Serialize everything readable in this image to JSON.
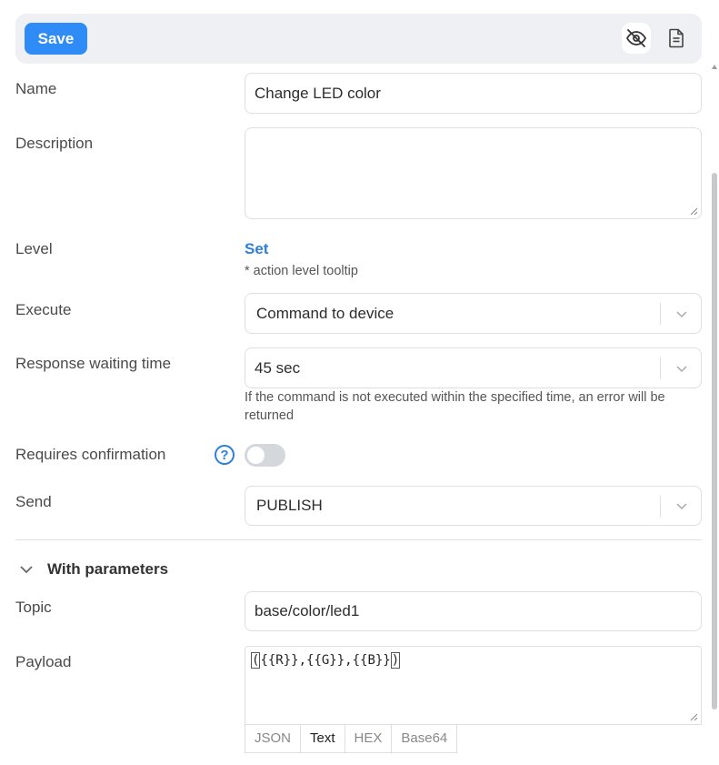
{
  "toolbar": {
    "save_label": "Save",
    "hide_icon": "eye-off-icon",
    "doc_icon": "document-icon"
  },
  "form": {
    "name": {
      "label": "Name",
      "value": "Change LED color"
    },
    "description": {
      "label": "Description",
      "value": ""
    },
    "level": {
      "label": "Level",
      "link": "Set",
      "hint": "* action level tooltip"
    },
    "execute": {
      "label": "Execute",
      "value": "Command to device"
    },
    "response_time": {
      "label": "Response waiting time",
      "value": "45 sec",
      "hint": "If the command is not executed within the specified time, an error will be returned"
    },
    "confirmation": {
      "label": "Requires confirmation",
      "help": "?",
      "enabled": false
    },
    "send": {
      "label": "Send",
      "value": "PUBLISH"
    }
  },
  "parameters": {
    "title": "With parameters",
    "topic": {
      "label": "Topic",
      "value": "base/color/led1"
    },
    "payload": {
      "label": "Payload",
      "open": "(",
      "body": "{{R}},{{G}},{{B}}",
      "close": ")"
    },
    "formats": [
      "JSON",
      "Text",
      "HEX",
      "Base64"
    ],
    "active_format": "Text"
  },
  "colors": {
    "accent": "#2f8bf5",
    "link": "#2f7fd8",
    "toolbar_bg": "#eef0f3",
    "border": "#dcdfe3"
  }
}
